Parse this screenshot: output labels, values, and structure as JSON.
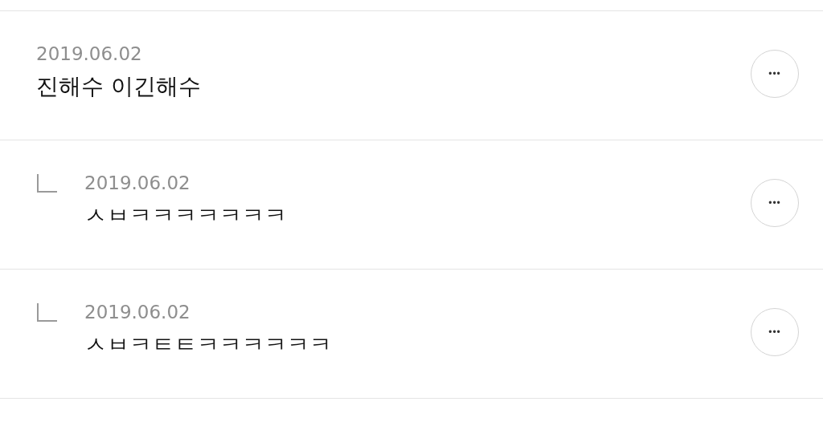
{
  "comments": [
    {
      "kind": "comment",
      "date": "2019.06.02",
      "text": "진해수 이긴해수",
      "menu": "•••"
    },
    {
      "kind": "reply",
      "date": "2019.06.02",
      "text": "ㅅㅂㅋㅋㅋㅋㅋㅋㅋ",
      "menu": "•••"
    },
    {
      "kind": "reply",
      "date": "2019.06.02",
      "text": "ㅅㅂㅋㅌㅌㅋㅋㅋㅋㅋㅋ",
      "menu": "•••"
    }
  ]
}
